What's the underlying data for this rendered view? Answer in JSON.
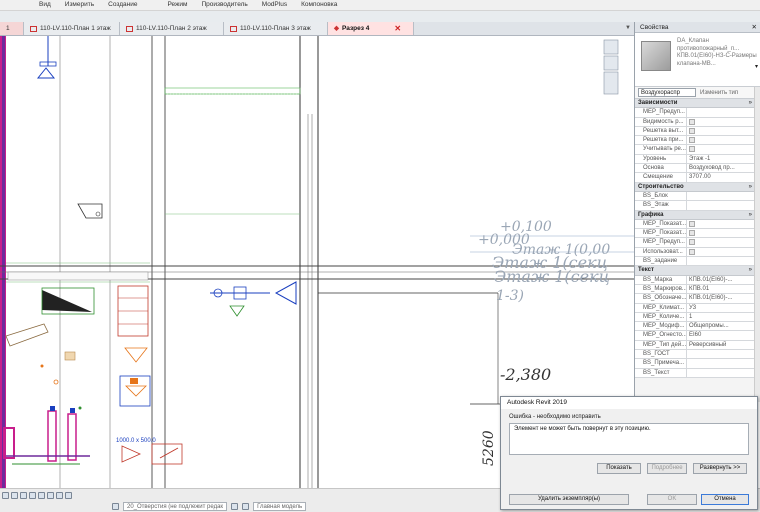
{
  "ribbon": {
    "menu": [
      "Вид",
      "Измерить",
      "Создание",
      "Режим",
      "Производитель",
      "ModPlus",
      "Компоновка"
    ]
  },
  "tabs": [
    {
      "label": "1",
      "active": false
    },
    {
      "label": "110-LV.110-План 1 этаж",
      "active": false
    },
    {
      "label": "110-LV.110-План 2 этаж",
      "active": false
    },
    {
      "label": "110-LV.110-План 3 этаж",
      "active": false
    },
    {
      "label": "Разрез 4",
      "active": true
    }
  ],
  "tab_close": "✕",
  "properties": {
    "title": "Свойства",
    "close": "✕",
    "type_name": "DA_Клапан противопожарный_п... КПВ.01(EI60)-НЗ-С-Размеры клапана-МВ...",
    "selector_value": "Воздухораспр",
    "edit_type": "Изменить тип",
    "sections": [
      {
        "name": "Зависимости",
        "rows": [
          {
            "k": "MEP_Предуп...",
            "v": "",
            "cb": false
          },
          {
            "k": "Видимость р...",
            "v": "",
            "cb": true
          },
          {
            "k": "Решетка выт...",
            "v": "",
            "cb": true
          },
          {
            "k": "Решетка при...",
            "v": "",
            "cb": true
          },
          {
            "k": "Учитывать ре...",
            "v": "",
            "cb": true
          },
          {
            "k": "Уровень",
            "v": "Этаж -1",
            "cb": false
          },
          {
            "k": "Основа",
            "v": "Воздуховод пр...",
            "cb": false
          },
          {
            "k": "Смещение",
            "v": "3707.00",
            "cb": false
          }
        ]
      },
      {
        "name": "Строительство",
        "rows": [
          {
            "k": "BS_Блок",
            "v": "",
            "cb": false
          },
          {
            "k": "BS_Этаж",
            "v": "",
            "cb": false
          }
        ]
      },
      {
        "name": "Графика",
        "rows": [
          {
            "k": "MEP_Показат...",
            "v": "",
            "cb": true
          },
          {
            "k": "MEP_Показат...",
            "v": "",
            "cb": true
          },
          {
            "k": "MEP_Предуп...",
            "v": "",
            "cb": true
          },
          {
            "k": "Использоват...",
            "v": "",
            "cb": true
          },
          {
            "k": "BS_задание",
            "v": "",
            "cb": false
          }
        ]
      },
      {
        "name": "Текст",
        "rows": [
          {
            "k": "BS_Марка",
            "v": "КПВ.01(EI60)-...",
            "cb": false
          },
          {
            "k": "BS_Маркиров...",
            "v": "КПВ.01",
            "cb": false
          },
          {
            "k": "BS_Обозначе...",
            "v": "КПВ.01(EI60)-...",
            "cb": false
          },
          {
            "k": "MEP_Климат...",
            "v": "У3",
            "cb": false
          },
          {
            "k": "MEP_Количе...",
            "v": "1",
            "cb": false
          },
          {
            "k": "MEP_Модиф...",
            "v": "Общепромы...",
            "cb": false
          },
          {
            "k": "MEP_Огнесто...",
            "v": "EI60",
            "cb": false
          },
          {
            "k": "MEP_Тип дей...",
            "v": "Реверсивный",
            "cb": false
          },
          {
            "k": "BS_ГОСТ",
            "v": "",
            "cb": false
          },
          {
            "k": "BS_Примеча...",
            "v": "",
            "cb": false
          },
          {
            "k": "BS_Текст",
            "v": "",
            "cb": false
          }
        ]
      }
    ]
  },
  "drawing": {
    "elev_text_1": "+0,100",
    "elev_text_2": "+0,000",
    "floor_text_1": "Этаж 1(0,00",
    "floor_text_2": "Этаж 1(секц",
    "floor_text_3": "Этаж 1(секц",
    "sect_text": "1-3)",
    "elev_neg": "-2,380",
    "dim_text": "5260",
    "duct_label": "1000.0 x 500.0"
  },
  "status": {
    "workset": "20_Отверстия (не подлежит редак",
    "model": "Главная модель"
  },
  "dialog": {
    "title": "Autodesk Revit 2019",
    "header": "Ошибка - необходимо исправить",
    "message": "Элемент не может быть повернут в эту позицию.",
    "btn_show": "Показать",
    "btn_more": "Подробнее",
    "btn_expand": "Развернуть >>",
    "btn_delete": "Удалить экземпляр(ы)",
    "btn_ok": "OK",
    "btn_cancel": "Отмена"
  }
}
